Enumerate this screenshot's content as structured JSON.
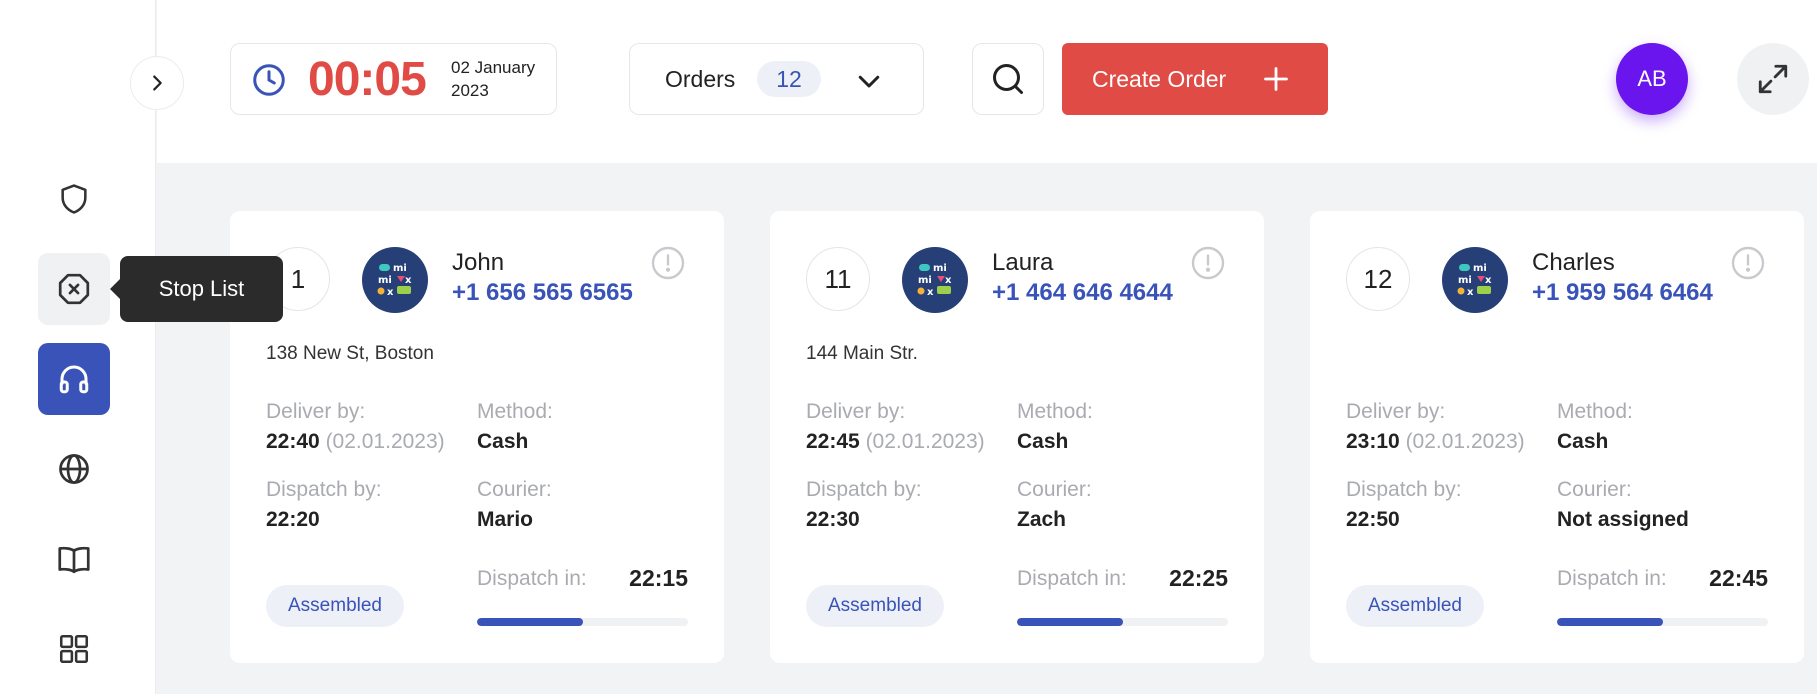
{
  "sidebar": {
    "items": [
      {
        "icon": "shield-icon",
        "state": "normal"
      },
      {
        "icon": "stop-octagon-icon",
        "state": "hover"
      },
      {
        "icon": "headphones-icon",
        "state": "active"
      },
      {
        "icon": "globe-icon",
        "state": "normal"
      },
      {
        "icon": "book-icon",
        "state": "normal"
      },
      {
        "icon": "grid-icon",
        "state": "normal"
      }
    ],
    "tooltip": "Stop List"
  },
  "header": {
    "timer": "00:05",
    "date_line1": "02 January",
    "date_line2": "2023",
    "orders_label": "Orders",
    "orders_count": "12",
    "create_label": "Create Order",
    "avatar_initials": "AB"
  },
  "colors": {
    "accent": "#3953b8",
    "danger": "#e04b45",
    "avatar": "#6a14ee"
  },
  "labels": {
    "deliver_by": "Deliver by:",
    "method": "Method:",
    "dispatch_by": "Dispatch by:",
    "courier": "Courier:",
    "dispatch_in": "Dispatch in:"
  },
  "orders": [
    {
      "number": "1",
      "name": "John",
      "phone": "+1 656 565 6565",
      "address": "138 New St, Boston",
      "deliver_time": "22:40",
      "deliver_date": "(02.01.2023)",
      "method": "Cash",
      "dispatch_by": "22:20",
      "courier": "Mario",
      "status": "Assembled",
      "dispatch_in": "22:15",
      "progress": 0.5
    },
    {
      "number": "11",
      "name": "Laura",
      "phone": "+1 464 646 4644",
      "address": "144 Main Str.",
      "deliver_time": "22:45",
      "deliver_date": "(02.01.2023)",
      "method": "Cash",
      "dispatch_by": "22:30",
      "courier": "Zach",
      "status": "Assembled",
      "dispatch_in": "22:25",
      "progress": 0.5
    },
    {
      "number": "12",
      "name": "Charles",
      "phone": "+1 959 564 6464",
      "address": "",
      "deliver_time": "23:10",
      "deliver_date": "(02.01.2023)",
      "method": "Cash",
      "dispatch_by": "22:50",
      "courier": "Not assigned",
      "status": "Assembled",
      "dispatch_in": "22:45",
      "progress": 0.5
    }
  ]
}
